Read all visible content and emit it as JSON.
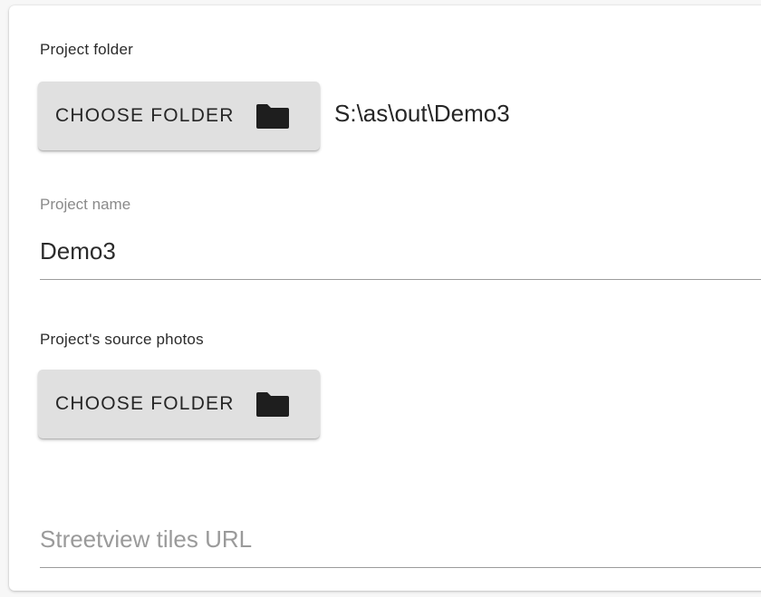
{
  "project_folder": {
    "label": "Project folder",
    "button_label": "CHOOSE FOLDER",
    "button_icon": "folder-icon",
    "selected_path": "S:\\as\\out\\Demo3"
  },
  "project_name": {
    "label": "Project name",
    "value": "Demo3"
  },
  "source_photos": {
    "label": "Project's source photos",
    "button_label": "CHOOSE FOLDER",
    "button_icon": "folder-icon"
  },
  "streetview": {
    "placeholder": "Streetview tiles URL"
  },
  "colors": {
    "button_bg": "#e0e0e0",
    "text": "#262626",
    "muted": "#8a8a8a",
    "underline": "#9c9c9c"
  }
}
